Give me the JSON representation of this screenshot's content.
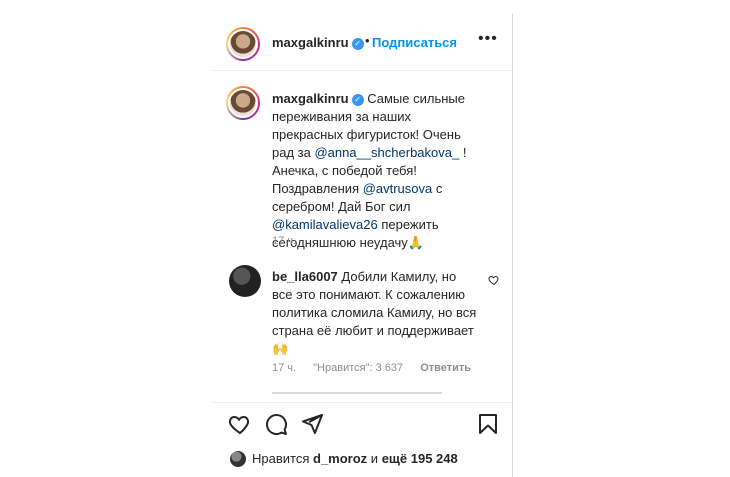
{
  "header": {
    "username": "maxgalkinru",
    "separator": "•",
    "follow_label": "Подписаться",
    "more_label": "•••"
  },
  "caption": {
    "username": "maxgalkinru",
    "text_1": "Самые сильные переживания за наших прекрасных фигуристок! Очень рад за",
    "mention_1": "@anna__shcherbakova_",
    "text_2": "! Анечка, с победой тебя! Поздравления",
    "mention_2": "@avtrusova",
    "text_3": "с серебром! Дай Бог сил",
    "mention_3": "@kamilavalieva26",
    "text_4": "пережить сегодняшнюю неудачу",
    "emoji": "🙏",
    "timestamp": "17 ч."
  },
  "comment": {
    "username": "be_lla6007",
    "text": "Добили Камилу, но все это понимают. К сожалению политика сломила Камилу, но вся страна её любит и поддерживает",
    "emoji": "🙌",
    "timestamp": "17 ч.",
    "likes": "\"Нравится\": 3 637",
    "reply_label": "Ответить"
  },
  "actions": {
    "like_icon": "heart-icon",
    "comment_icon": "comment-icon",
    "share_icon": "share-icon",
    "save_icon": "bookmark-icon"
  },
  "likes_row": {
    "prefix": "Нравится",
    "user": "d_moroz",
    "middle": "и",
    "count": "ещё 195 248"
  },
  "colors": {
    "accent": "#0095f6",
    "verified": "#3897f0",
    "mention": "#00376b",
    "muted": "#8e8e8e"
  }
}
